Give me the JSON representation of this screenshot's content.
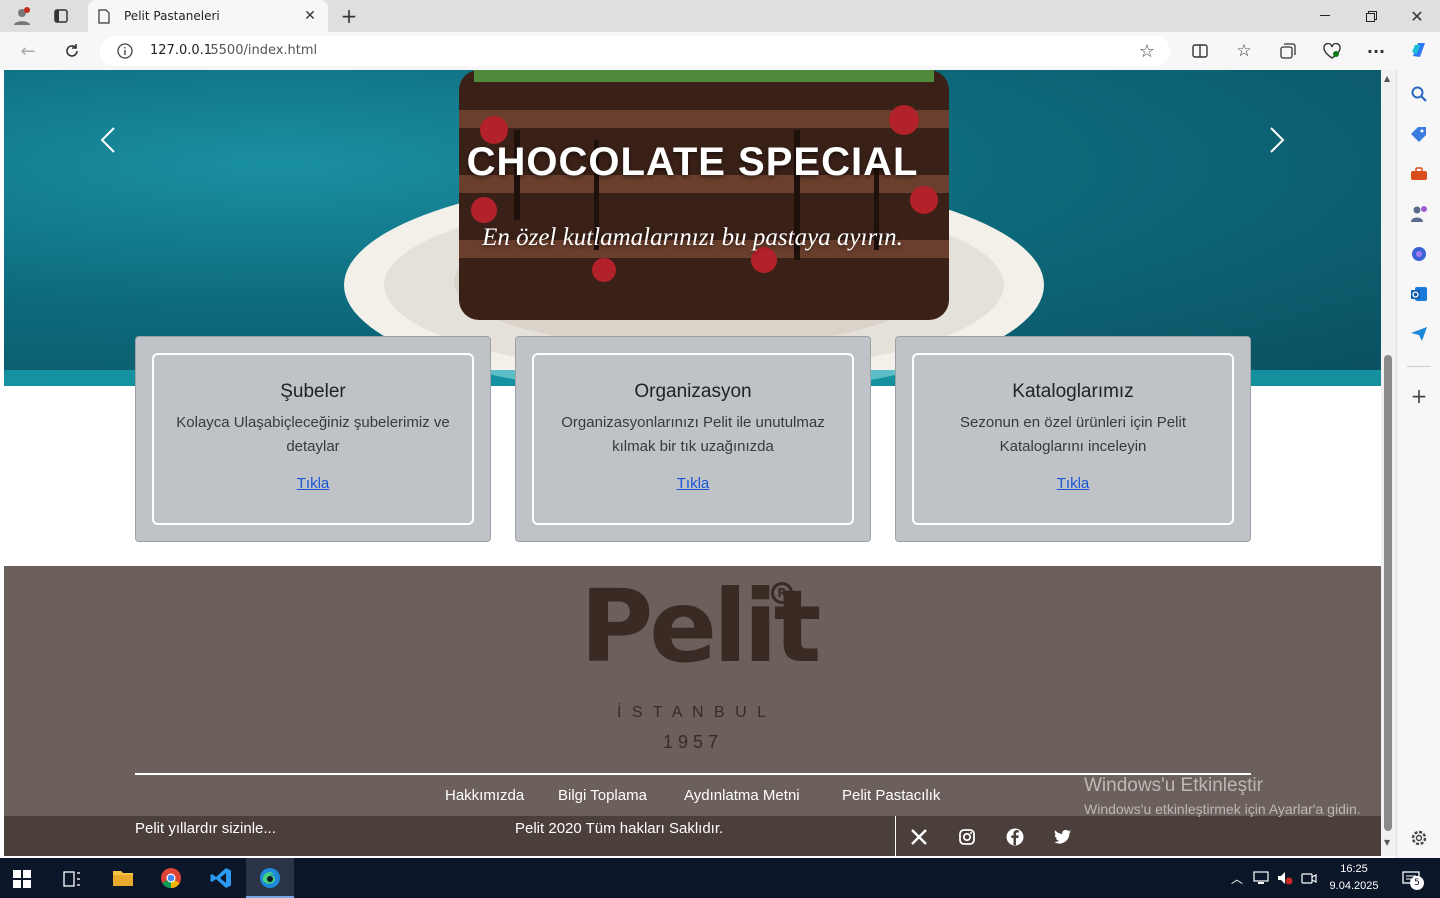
{
  "browser": {
    "tab_title": "Pelit Pastaneleri",
    "url_host": "127.0.0.1",
    "url_path": ":5500/index.html"
  },
  "hero": {
    "title": "CHOCOLATE SPECIAL",
    "subtitle": "En özel kutlamalarınızı bu pastaya ayırın."
  },
  "cards": [
    {
      "title": "Şubeler",
      "desc": "Kolayca Ulaşabiçleceğiniz şubelerimiz ve detaylar",
      "link": "Tıkla"
    },
    {
      "title": "Organizasyon",
      "desc": "Organizasyonlarınızı Pelit ile unutulmaz kılmak bir tık uzağınızda",
      "link": "Tıkla"
    },
    {
      "title": "Kataloglarımız",
      "desc": "Sezonun en özel ürünleri için Pelit Kataloglarını inceleyin",
      "link": "Tıkla"
    }
  ],
  "footer": {
    "logo_text": "Pelit",
    "logo_city": "İ S T A N B U L",
    "logo_year": "1957",
    "links": [
      "Hakkımızda",
      "Bilgi Toplama",
      "Aydınlatma Metni",
      "Pelit Pastacılık"
    ],
    "tagline": "Pelit yıllardır sizinle...",
    "copyright": "Pelit 2020 Tüm hakları Saklıdır.",
    "social_icons": [
      "x-icon",
      "instagram-icon",
      "facebook-icon",
      "twitter-icon"
    ]
  },
  "watermark": {
    "title": "Windows'u Etkinleştir",
    "subtitle": "Windows'u etkinleştirmek için Ayarlar'a gidin."
  },
  "taskbar": {
    "time": "16:25",
    "date": "9.04.2025",
    "notifications": "5"
  }
}
